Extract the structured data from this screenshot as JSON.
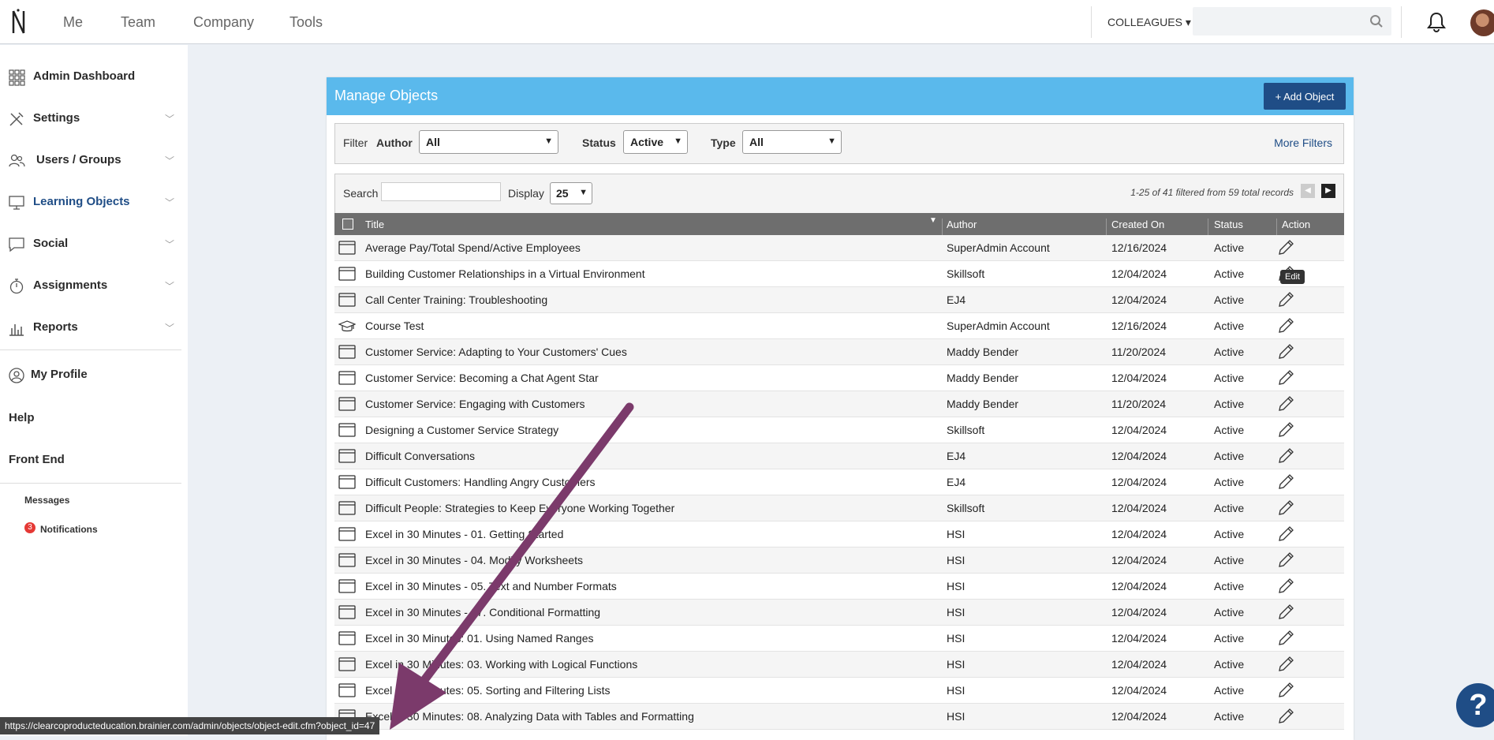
{
  "topnav": {
    "items": [
      "Me",
      "Team",
      "Company",
      "Tools"
    ],
    "colleagues_label": "COLLEAGUES ▾",
    "search_placeholder": ""
  },
  "sidebar": {
    "items": [
      {
        "label": "Admin Dashboard",
        "icon": "grid-icon"
      },
      {
        "label": "Settings",
        "icon": "tools-icon"
      },
      {
        "label": "Users / Groups",
        "icon": "users-icon"
      },
      {
        "label": "Learning Objects",
        "icon": "monitor-icon"
      },
      {
        "label": "Social",
        "icon": "chat-icon"
      },
      {
        "label": "Assignments",
        "icon": "stopwatch-icon"
      },
      {
        "label": "Reports",
        "icon": "bar-chart-icon"
      }
    ],
    "profile_label": "My Profile",
    "help_label": "Help",
    "front_end_label": "Front End",
    "messages_label": "Messages",
    "notifications_label": "Notifications",
    "notifications_count": "3"
  },
  "panel": {
    "title": "Manage Objects",
    "add_button": "+ Add Object"
  },
  "filters": {
    "filter_label": "Filter",
    "author_label": "Author",
    "author_value": "All",
    "status_label": "Status",
    "status_value": "Active",
    "type_label": "Type",
    "type_value": "All",
    "more_filters": "More Filters"
  },
  "search": {
    "label": "Search",
    "display_label": "Display",
    "display_value": "25",
    "records": "1-25 of 41 filtered from 59 total records"
  },
  "table": {
    "columns": [
      "Title",
      "Author",
      "Created On",
      "Status",
      "Action"
    ],
    "rows": [
      {
        "title": "Average Pay/Total Spend/Active Employees",
        "author": "SuperAdmin Account",
        "created": "12/16/2024",
        "status": "Active",
        "icon": "window-icon"
      },
      {
        "title": "Building Customer Relationships in a Virtual Environment",
        "author": "Skillsoft",
        "created": "12/04/2024",
        "status": "Active",
        "icon": "window-icon"
      },
      {
        "title": "Call Center Training: Troubleshooting",
        "author": "EJ4",
        "created": "12/04/2024",
        "status": "Active",
        "icon": "window-icon"
      },
      {
        "title": "Course Test",
        "author": "SuperAdmin Account",
        "created": "12/16/2024",
        "status": "Active",
        "icon": "graduation-cap-icon"
      },
      {
        "title": "Customer Service: Adapting to Your Customers' Cues",
        "author": "Maddy Bender",
        "created": "11/20/2024",
        "status": "Active",
        "icon": "window-icon"
      },
      {
        "title": "Customer Service: Becoming a Chat Agent Star",
        "author": "Maddy Bender",
        "created": "12/04/2024",
        "status": "Active",
        "icon": "window-icon"
      },
      {
        "title": "Customer Service: Engaging with Customers",
        "author": "Maddy Bender",
        "created": "11/20/2024",
        "status": "Active",
        "icon": "window-icon"
      },
      {
        "title": "Designing a Customer Service Strategy",
        "author": "Skillsoft",
        "created": "12/04/2024",
        "status": "Active",
        "icon": "window-icon"
      },
      {
        "title": "Difficult Conversations",
        "author": "EJ4",
        "created": "12/04/2024",
        "status": "Active",
        "icon": "window-icon"
      },
      {
        "title": "Difficult Customers: Handling Angry Customers",
        "author": "EJ4",
        "created": "12/04/2024",
        "status": "Active",
        "icon": "window-icon"
      },
      {
        "title": "Difficult People: Strategies to Keep Everyone Working Together",
        "author": "Skillsoft",
        "created": "12/04/2024",
        "status": "Active",
        "icon": "window-icon"
      },
      {
        "title": "Excel in 30 Minutes - 01. Getting Started",
        "author": "HSI",
        "created": "12/04/2024",
        "status": "Active",
        "icon": "window-icon"
      },
      {
        "title": "Excel in 30 Minutes - 04. Modify Worksheets",
        "author": "HSI",
        "created": "12/04/2024",
        "status": "Active",
        "icon": "window-icon"
      },
      {
        "title": "Excel in 30 Minutes - 05. Text and Number Formats",
        "author": "HSI",
        "created": "12/04/2024",
        "status": "Active",
        "icon": "window-icon"
      },
      {
        "title": "Excel in 30 Minutes - 07. Conditional Formatting",
        "author": "HSI",
        "created": "12/04/2024",
        "status": "Active",
        "icon": "window-icon"
      },
      {
        "title": "Excel in 30 Minutes: 01. Using Named Ranges",
        "author": "HSI",
        "created": "12/04/2024",
        "status": "Active",
        "icon": "window-icon"
      },
      {
        "title": "Excel in 30 Minutes: 03. Working with Logical Functions",
        "author": "HSI",
        "created": "12/04/2024",
        "status": "Active",
        "icon": "window-icon"
      },
      {
        "title": "Excel in 30 Minutes: 05. Sorting and Filtering Lists",
        "author": "HSI",
        "created": "12/04/2024",
        "status": "Active",
        "icon": "window-icon"
      },
      {
        "title": "Excel in 30 Minutes: 08. Analyzing Data with Tables and Formatting",
        "author": "HSI",
        "created": "12/04/2024",
        "status": "Active",
        "icon": "window-icon"
      }
    ]
  },
  "tooltip": "Edit",
  "status_url": "https://clearcoproducteducation.brainier.com/admin/objects/object-edit.cfm?object_id=47",
  "help_button": "?",
  "colors": {
    "header_blue": "#5ab9ec",
    "navy": "#1f4d86",
    "arrow": "#7b3a6b",
    "table_header": "#6e6e6e",
    "badge_red": "#e53935"
  }
}
